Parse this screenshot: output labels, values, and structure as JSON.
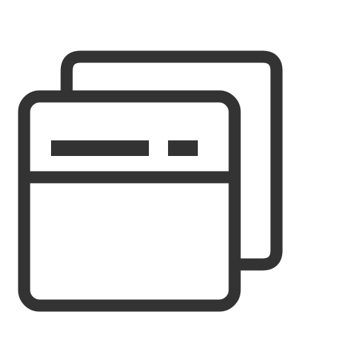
{
  "icon": {
    "name": "stacked-windows-icon",
    "stroke_color": "#333333",
    "background_color": "#ffffff"
  }
}
